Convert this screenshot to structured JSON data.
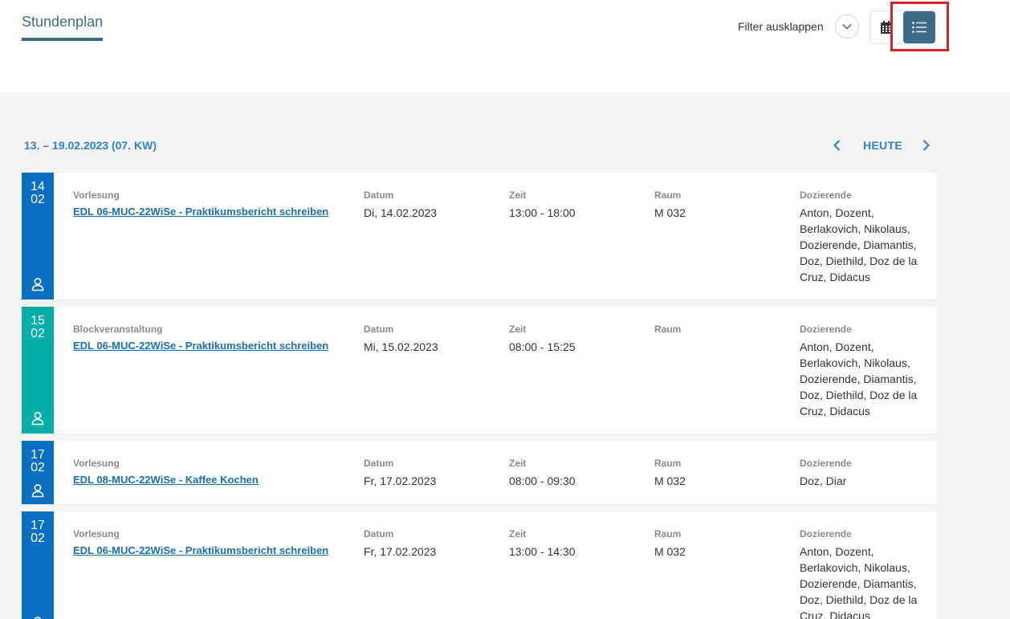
{
  "header": {
    "title": "Stundenplan",
    "filter_label": "Filter ausklappen"
  },
  "week": {
    "range": "13. – 19.02.2023 (07. KW)",
    "today": "HEUTE"
  },
  "labels": {
    "date": "Datum",
    "time": "Zeit",
    "room": "Raum",
    "lecturers": "Dozierende"
  },
  "colors": {
    "accent": "#3d6b87",
    "link": "#1a6fb3",
    "vorlesung": "#0a6fc2",
    "block": "#00b0a8",
    "highlight": "#d9232b"
  },
  "events": [
    {
      "day": "14",
      "month": "02",
      "type": "Vorlesung",
      "title": "EDL 06-MUC-22WiSe - Praktikumsbericht schreiben",
      "date": "Di, 14.02.2023",
      "time": "13:00 - 18:00",
      "room": "M 032",
      "lecturers": "Anton, Dozent, Berlakovich, Nikolaus, Dozierende, Diamantis, Doz, Diethild, Doz de la Cruz, Didacus"
    },
    {
      "day": "15",
      "month": "02",
      "type": "Blockveranstaltung",
      "title": "EDL 06-MUC-22WiSe - Praktikumsbericht schreiben",
      "date": "Mi, 15.02.2023",
      "time": "08:00 - 15:25",
      "room": "",
      "lecturers": "Anton, Dozent, Berlakovich, Nikolaus, Dozierende, Diamantis, Doz, Diethild, Doz de la Cruz, Didacus"
    },
    {
      "day": "17",
      "month": "02",
      "type": "Vorlesung",
      "title": "EDL 08-MUC-22WiSe - Kaffee Kochen",
      "date": "Fr, 17.02.2023",
      "time": "08:00 - 09:30",
      "room": "M 032",
      "lecturers": "Doz, Diar"
    },
    {
      "day": "17",
      "month": "02",
      "type": "Vorlesung",
      "title": "EDL 06-MUC-22WiSe - Praktikumsbericht schreiben",
      "date": "Fr, 17.02.2023",
      "time": "13:00 - 14:30",
      "room": "M 032",
      "lecturers": "Anton, Dozent, Berlakovich, Nikolaus, Dozierende, Diamantis, Doz, Diethild, Doz de la Cruz, Didacus"
    }
  ]
}
